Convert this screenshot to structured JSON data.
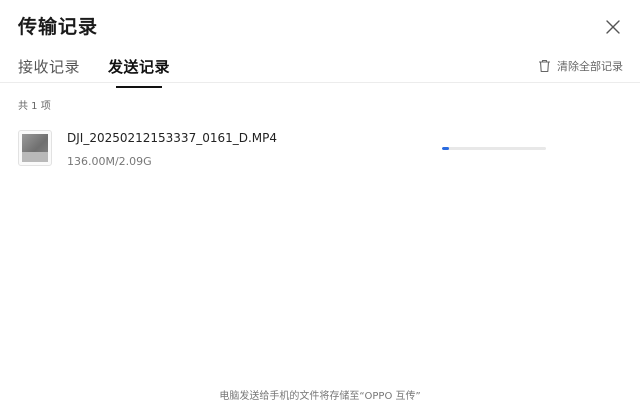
{
  "window": {
    "title": "传输记录"
  },
  "tabs": [
    {
      "label": "接收记录",
      "active": false
    },
    {
      "label": "发送记录",
      "active": true
    }
  ],
  "toolbar": {
    "clear_all_label": "清除全部记录",
    "clear_icon": "trash-icon",
    "close_icon": "close-icon"
  },
  "list": {
    "count_label": "共 1 项",
    "items": [
      {
        "file_name": "DJI_20250212153337_0161_D.MP4",
        "size_progress": "136.00M/2.09G",
        "progress_fraction": 0.065
      }
    ]
  },
  "footer": {
    "note": "电脑发送给手机的文件将存储至“OPPO 互传”"
  },
  "colors": {
    "progress_fill": "#2a6be0",
    "progress_track": "#e8e8e8"
  }
}
